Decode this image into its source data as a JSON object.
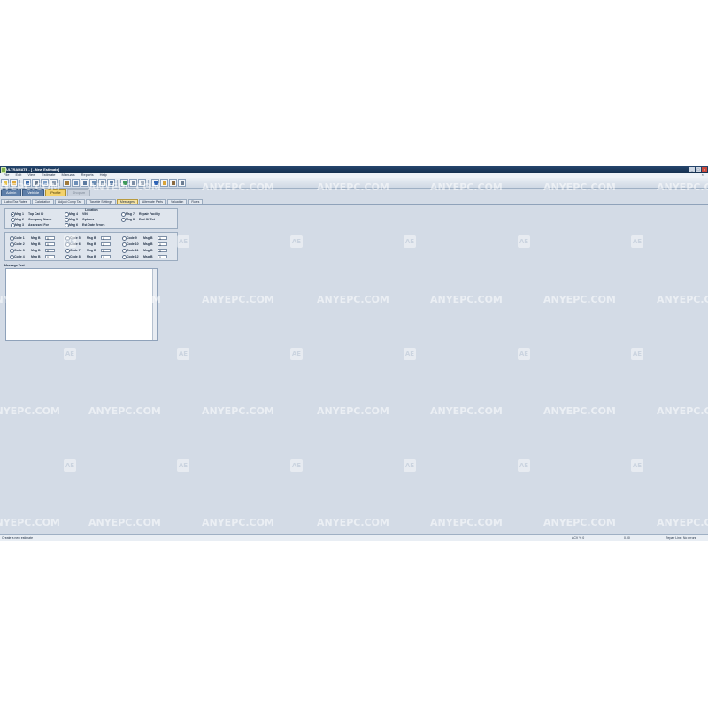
{
  "window": {
    "title": "ULTRAMATE - [ - New Estimate]",
    "min": "_",
    "max": "□",
    "close": "×"
  },
  "menu": [
    "File",
    "Edit",
    "View",
    "Estimate",
    "Manuals",
    "Reports",
    "Help"
  ],
  "menu_close": "×",
  "toolbar_icons": [
    {
      "name": "new-icon",
      "color": "#e7c24a"
    },
    {
      "name": "open-icon",
      "color": "#e0a93a"
    },
    {
      "name": "save-icon",
      "color": "#3f6fb0"
    },
    {
      "name": "print-icon",
      "color": "#6b7c90"
    },
    {
      "name": "preview-icon",
      "color": "#7ea0c8"
    },
    {
      "name": "copy-icon",
      "color": "#8b9bb0"
    },
    {
      "name": "paste-icon",
      "color": "#a07a3a"
    },
    {
      "name": "grid-icon",
      "color": "#6d8fb8"
    },
    {
      "name": "list-icon",
      "color": "#5c7aa0"
    },
    {
      "name": "parts-icon",
      "color": "#6a8cb3"
    },
    {
      "name": "labor-icon",
      "color": "#7f95ae"
    },
    {
      "name": "calc-icon",
      "color": "#5f7fa8"
    },
    {
      "name": "photo-icon",
      "color": "#3f9a5a"
    },
    {
      "name": "mail-icon",
      "color": "#7c8ea6"
    },
    {
      "name": "attach-icon",
      "color": "#a4b0bf"
    },
    {
      "name": "help-icon",
      "color": "#2f63b5"
    },
    {
      "name": "key-icon",
      "color": "#d8a43a"
    },
    {
      "name": "tools-icon",
      "color": "#8a6a40"
    },
    {
      "name": "tool-icon",
      "color": "#6c7d92"
    }
  ],
  "main_tabs": [
    {
      "label": "Admin",
      "state": "normal"
    },
    {
      "label": "Vehicle",
      "state": "normal"
    },
    {
      "label": "Profile",
      "state": "active"
    },
    {
      "label": "Shopsm",
      "state": "disabled"
    }
  ],
  "sub_tabs": [
    {
      "label": "Labor/Tax Rates",
      "active": false
    },
    {
      "label": "Calculation",
      "active": false
    },
    {
      "label": "Adjust Comp Tax",
      "active": false
    },
    {
      "label": "Taxable Settings",
      "active": false
    },
    {
      "label": "Messages",
      "active": true
    },
    {
      "label": "Alternate Parts",
      "active": false
    },
    {
      "label": "Valuation",
      "active": false
    },
    {
      "label": "Rules",
      "active": false
    }
  ],
  "messages": {
    "location_header": "Location",
    "columns": [
      [
        {
          "msg": "Msg 1",
          "desc": "Top Cat ID",
          "selected": true
        },
        {
          "msg": "Msg 2",
          "desc": "Company Name",
          "selected": false
        },
        {
          "msg": "Msg 3",
          "desc": "Assessed For",
          "selected": false
        }
      ],
      [
        {
          "msg": "Msg 4",
          "desc": "VIN",
          "selected": false
        },
        {
          "msg": "Msg 5",
          "desc": "Options",
          "selected": false
        },
        {
          "msg": "Msg 6",
          "desc": "Est Date Errors",
          "selected": false
        }
      ],
      [
        {
          "msg": "Msg 7",
          "desc": "Repair Facility",
          "selected": false
        },
        {
          "msg": "Msg 8",
          "desc": "End Of Est",
          "selected": false
        }
      ]
    ]
  },
  "codes": {
    "msg_label": "Msg B",
    "columns": [
      [
        {
          "code": "Code 1",
          "value": "0"
        },
        {
          "code": "Code 2",
          "value": "0"
        },
        {
          "code": "Code 3",
          "value": "0"
        },
        {
          "code": "Code 4",
          "value": "0"
        }
      ],
      [
        {
          "code": "Code 5",
          "value": "0"
        },
        {
          "code": "Code 6",
          "value": "0"
        },
        {
          "code": "Code 7",
          "value": "0"
        },
        {
          "code": "Code 8",
          "value": "0"
        }
      ],
      [
        {
          "code": "Code 9",
          "value": "0"
        },
        {
          "code": "Code 10",
          "value": "0"
        },
        {
          "code": "Code 11",
          "value": "0"
        },
        {
          "code": "Code 12",
          "value": "0"
        }
      ]
    ]
  },
  "message_text_label": "Message Text",
  "status": {
    "left": "Create a new estimate",
    "acv": "ACV % 0",
    "value": "0.00",
    "right": "Repair Line: No errors"
  },
  "watermark": {
    "text": "ANYEPC.COM",
    "logo": "AE"
  }
}
